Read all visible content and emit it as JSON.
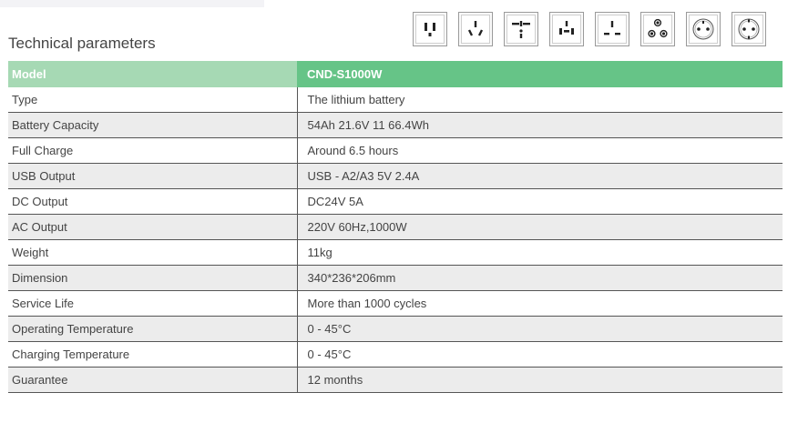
{
  "heading": "Technical parameters",
  "icons": [
    "us-socket-icon",
    "au-socket-icon",
    "universal-socket-icon",
    "multi-socket-icon",
    "uk-socket-icon",
    "india-socket-icon",
    "french-socket-icon",
    "schuko-socket-icon"
  ],
  "table": {
    "header": {
      "label": "Model",
      "value": "CND-S1000W"
    },
    "rows": [
      {
        "label": "Type",
        "value": "The lithium battery"
      },
      {
        "label": "Battery Capacity",
        "value": "54Ah 21.6V 11 66.4Wh"
      },
      {
        "label": "Full Charge",
        "value": "Around 6.5 hours"
      },
      {
        "label": "USB Output",
        "value": "USB - A2/A3 5V 2.4A"
      },
      {
        "label": "DC Output",
        "value": "DC24V 5A"
      },
      {
        "label": "AC Output",
        "value": "220V 60Hz,1000W"
      },
      {
        "label": "Weight",
        "value": "11kg"
      },
      {
        "label": "Dimension",
        "value": "340*236*206mm"
      },
      {
        "label": "Service Life",
        "value": "More than 1000 cycles"
      },
      {
        "label": "Operating Temperature",
        "value": "0 - 45°C"
      },
      {
        "label": "Charging Temperature",
        "value": "0 - 45°C"
      },
      {
        "label": "Guarantee",
        "value": "12 months"
      }
    ]
  },
  "colors": {
    "header_left": "#a6d9b4",
    "header_right": "#66c487",
    "stripe": "#ececec",
    "text": "#444444"
  }
}
